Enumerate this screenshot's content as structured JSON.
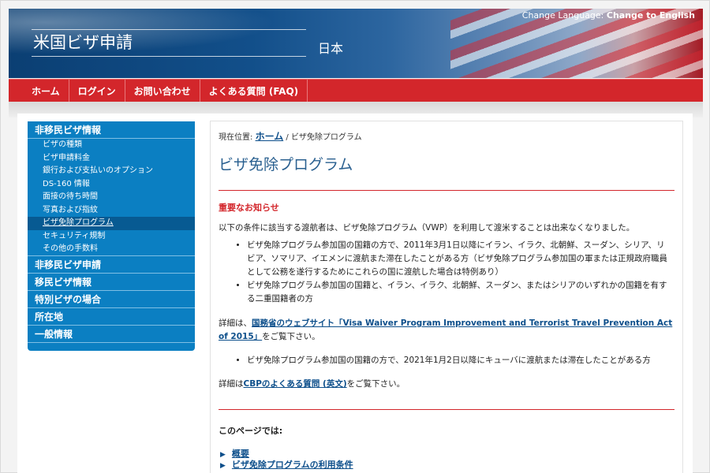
{
  "header": {
    "site_title": "米国ビザ申請",
    "country": "日本",
    "change_language_label": "Change Language: ",
    "change_language_link": "Change to English"
  },
  "nav": [
    {
      "label": "ホーム"
    },
    {
      "label": "ログイン"
    },
    {
      "label": "お問い合わせ"
    },
    {
      "label": "よくある質問 (FAQ)"
    }
  ],
  "sidebar": {
    "sections": [
      {
        "title": "非移民ビザ情報"
      },
      {
        "title": "非移民ビザ申請"
      },
      {
        "title": "移民ビザ情報"
      },
      {
        "title": "特別ビザの場合"
      },
      {
        "title": "所在地"
      },
      {
        "title": "一般情報"
      }
    ],
    "sub_items": [
      {
        "label": "ビザの種類"
      },
      {
        "label": "ビザ申請料金"
      },
      {
        "label": "銀行および支払いのオプション"
      },
      {
        "label": "DS-160 情報"
      },
      {
        "label": "面接の待ち時間"
      },
      {
        "label": "写真および指紋"
      },
      {
        "label": "ビザ免除プログラム"
      },
      {
        "label": "セキュリティ規制"
      },
      {
        "label": "その他の手数料"
      }
    ]
  },
  "content": {
    "breadcrumb_prefix": "現在位置: ",
    "breadcrumb_home": "ホーム",
    "breadcrumb_rest": " / ビザ免除プログラム",
    "title": "ビザ免除プログラム",
    "notice_heading": "重要なお知らせ",
    "intro": "以下の条件に該当する渡航者は、ビザ免除プログラム（VWP）を利用して渡米することは出来なくなりました。",
    "bullets_1": [
      "ビザ免除プログラム参加国の国籍の方で、2011年3月1日以降にイラン、イラク、北朝鮮、スーダン、シリア、リビア、ソマリア、イエメンに渡航また滞在したことがある方（ビザ免除プログラム参加国の軍または正規政府職員として公務を遂行するためにこれらの国に渡航した場合は特例あり）",
      "ビザ免除プログラム参加国の国籍と、イラン、イラク、北朝鮮、スーダン、またはシリアのいずれかの国籍を有する二重国籍者の方"
    ],
    "details_prefix": "詳細は、",
    "details_link": "国務省のウェブサイト「Visa Waiver Program Improvement and Terrorist Travel Prevention Act of 2015」",
    "details_suffix": "をご覧下さい。",
    "bullets_2": [
      "ビザ免除プログラム参加国の国籍の方で、2021年1月2日以降にキューバに渡航または滞在したことがある方"
    ],
    "cbp_prefix": "詳細は",
    "cbp_link": "CBPのよくある質問 (英文)",
    "cbp_suffix": "をご覧下さい。",
    "in_page_heading": "このページでは:",
    "anchors": [
      {
        "label": "概要"
      },
      {
        "label": "ビザ免除プログラムの利用条件"
      }
    ]
  },
  "colors": {
    "header_blue": "#0b3f73",
    "nav_red": "#d3262b",
    "sidebar_blue": "#0b7fc2",
    "title_blue": "#2a6090",
    "link_blue": "#0d4f8b"
  }
}
